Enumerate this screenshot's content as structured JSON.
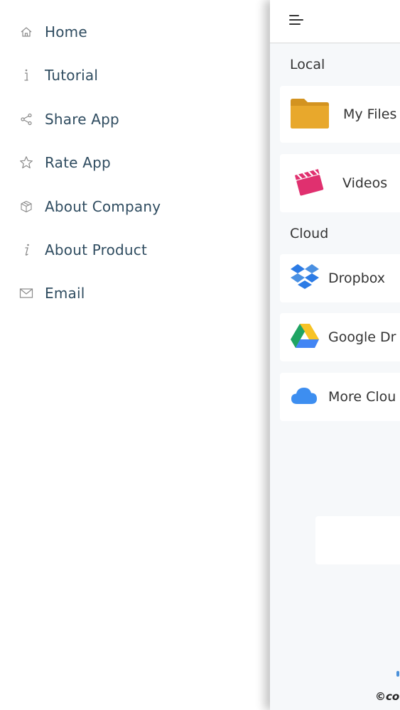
{
  "drawer": {
    "items": [
      {
        "label": "Home",
        "icon": "home-icon"
      },
      {
        "label": "Tutorial",
        "icon": "info-icon"
      },
      {
        "label": "Share App",
        "icon": "share-icon"
      },
      {
        "label": "Rate App",
        "icon": "star-icon"
      },
      {
        "label": "About Company",
        "icon": "box-icon"
      },
      {
        "label": "About Product",
        "icon": "info-italic-icon"
      },
      {
        "label": "Email",
        "icon": "mail-icon"
      }
    ]
  },
  "main": {
    "sections": {
      "local": "Local",
      "cloud": "Cloud"
    },
    "local_items": [
      {
        "label": "My Files",
        "icon": "folder-icon"
      },
      {
        "label": "Videos",
        "icon": "clapperboard-icon"
      }
    ],
    "cloud_items": [
      {
        "label": "Dropbox",
        "icon": "dropbox-icon"
      },
      {
        "label": "Google Dr",
        "icon": "google-drive-icon"
      },
      {
        "label": "More Clou",
        "icon": "cloud-icon"
      }
    ],
    "footer": "©co"
  },
  "colors": {
    "menu_text": "#2f4c60",
    "folder": "#e3a12b",
    "video": "#e0306f",
    "dropbox": "#2c7be5",
    "cloud": "#3d8ef0"
  }
}
